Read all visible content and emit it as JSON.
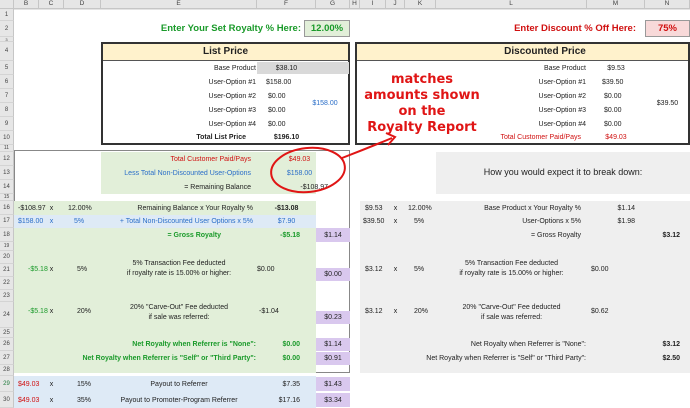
{
  "columns": [
    "B",
    "C",
    "D",
    "E",
    "F",
    "G",
    "H",
    "I",
    "J",
    "K",
    "L",
    "M",
    "N"
  ],
  "rows": [
    "1",
    "2",
    "3",
    "4",
    "5",
    "6",
    "7",
    "8",
    "9",
    "10",
    "11",
    "12",
    "13",
    "14",
    "15",
    "16",
    "17",
    "18",
    "19",
    "20",
    "21",
    "22",
    "23",
    "24",
    "25",
    "26",
    "27",
    "28",
    "29",
    "30"
  ],
  "royalty": {
    "label": "Enter Your Set Royalty % Here:",
    "value": "12.00%"
  },
  "discount": {
    "label": "Enter Discount % Off Here:",
    "value": "75%"
  },
  "list": {
    "title": "List Price",
    "base_label": "Base Product",
    "base_value": "$38.10",
    "opt1_label": "User-Option #1",
    "opt1_value": "$158.00",
    "opt2_label": "User-Option #2",
    "opt2_value": "$0.00",
    "opt3_label": "User-Option #3",
    "opt3_value": "$0.00",
    "opt4_label": "User-Option #4",
    "opt4_value": "$0.00",
    "opt_total": "$158.00",
    "total_label": "Total List Price",
    "total_value": "$196.10"
  },
  "disc": {
    "title": "Discounted Price",
    "base_label": "Base Product",
    "base_value": "$9.53",
    "opt1_label": "User-Option #1",
    "opt1_value": "$39.50",
    "opt2_label": "User-Option #2",
    "opt2_value": "$0.00",
    "opt3_label": "User-Option #3",
    "opt3_value": "$0.00",
    "opt4_label": "User-Option #4",
    "opt4_value": "$0.00",
    "opt_total": "$39.50",
    "total_label": "Total Customer Paid/Pays",
    "total_value": "$49.03"
  },
  "annotation": {
    "line1": "matches",
    "line2": "amounts shown",
    "line3": "on the",
    "line4": "Royalty Report"
  },
  "left": {
    "paid_label": "Total Customer Paid/Pays",
    "paid_value": "$49.03",
    "nondisc_label": "Less Total Non-Discounted User-Options",
    "nondisc_value": "$158.00",
    "remain_label": "= Remaining Balance",
    "remain_value": "-$108.97",
    "r16_b": "-$108.97",
    "r16_x": "x",
    "r16_d": "12.00%",
    "r16_e": "Remaining Balance x Your Royalty %",
    "r16_f": "-$13.08",
    "r17_b": "$158.00",
    "r17_x": "x",
    "r17_d": "5%",
    "r17_e": "+ Total Non-Discounted User Options x 5%",
    "r17_f": "$7.90",
    "r18_e": "= Gross Royalty",
    "r18_f": "-$5.18",
    "r18_g": "$1.14",
    "fee1_b": "-$5.18",
    "fee1_x": "x",
    "fee1_d": "5%",
    "fee1_e1": "5% Transaction Fee deducted",
    "fee1_e2": "if royalty rate is 15.00% or higher:",
    "fee1_f": "$0.00",
    "fee1_g": "$0.00",
    "fee2_b": "-$5.18",
    "fee2_x": "x",
    "fee2_d": "20%",
    "fee2_e1": "20% \"Carve-Out\" Fee deducted",
    "fee2_e2": "if sale was referred:",
    "fee2_f": "-$1.04",
    "fee2_g": "$0.23",
    "net1_label": "Net Royalty when Referrer is \"None\":",
    "net1_f": "$0.00",
    "net1_g": "$1.14",
    "net2_label": "Net Royalty when Referrer is \"Self\" or \"Third Party\":",
    "net2_f": "$0.00",
    "net2_g": "$0.91",
    "r29_b": "$49.03",
    "r29_x": "x",
    "r29_d": "15%",
    "r29_e": "Payout to Referrer",
    "r29_f": "$7.35",
    "r29_g": "$1.43",
    "r30_b": "$49.03",
    "r30_x": "x",
    "r30_d": "35%",
    "r30_e": "Payout to Promoter-Program Referrer",
    "r30_f": "$17.16",
    "r30_g": "$3.34"
  },
  "right": {
    "expect": "How you would expect it to break down:",
    "r16_i": "$9.53",
    "r16_x": "x",
    "r16_k": "12.00%",
    "r16_l": "Base Product x Your Royalty %",
    "r16_m": "$1.14",
    "r17_i": "$39.50",
    "r17_x": "x",
    "r17_k": "5%",
    "r17_l": "User-Options x 5%",
    "r17_m": "$1.98",
    "r18_l": "= Gross  Royalty",
    "r18_n": "$3.12",
    "fee1_i": "$3.12",
    "fee1_x": "x",
    "fee1_k": "5%",
    "fee1_l1": "5% Transaction Fee deducted",
    "fee1_l2": "if royalty rate is 15.00% or higher:",
    "fee1_m": "$0.00",
    "fee2_i": "$3.12",
    "fee2_x": "x",
    "fee2_k": "20%",
    "fee2_l1": "20% \"Carve-Out\" Fee deducted",
    "fee2_l2": "if sale was referred:",
    "fee2_m": "$0.62",
    "net1_label": "Net Royalty when Referrer is \"None\":",
    "net1_n": "$3.12",
    "net2_label": "Net Royalty when Referrer is \"Self\" or \"Third Party\":",
    "net2_n": "$2.50"
  },
  "colors": {
    "green_fill": "#e2efd9",
    "blue_fill": "#deeaf6",
    "purple_fill": "#d9c8ee",
    "gray_fill": "#efefef",
    "yellow_fill": "#fff2cc",
    "annotation_red": "#e01515"
  }
}
